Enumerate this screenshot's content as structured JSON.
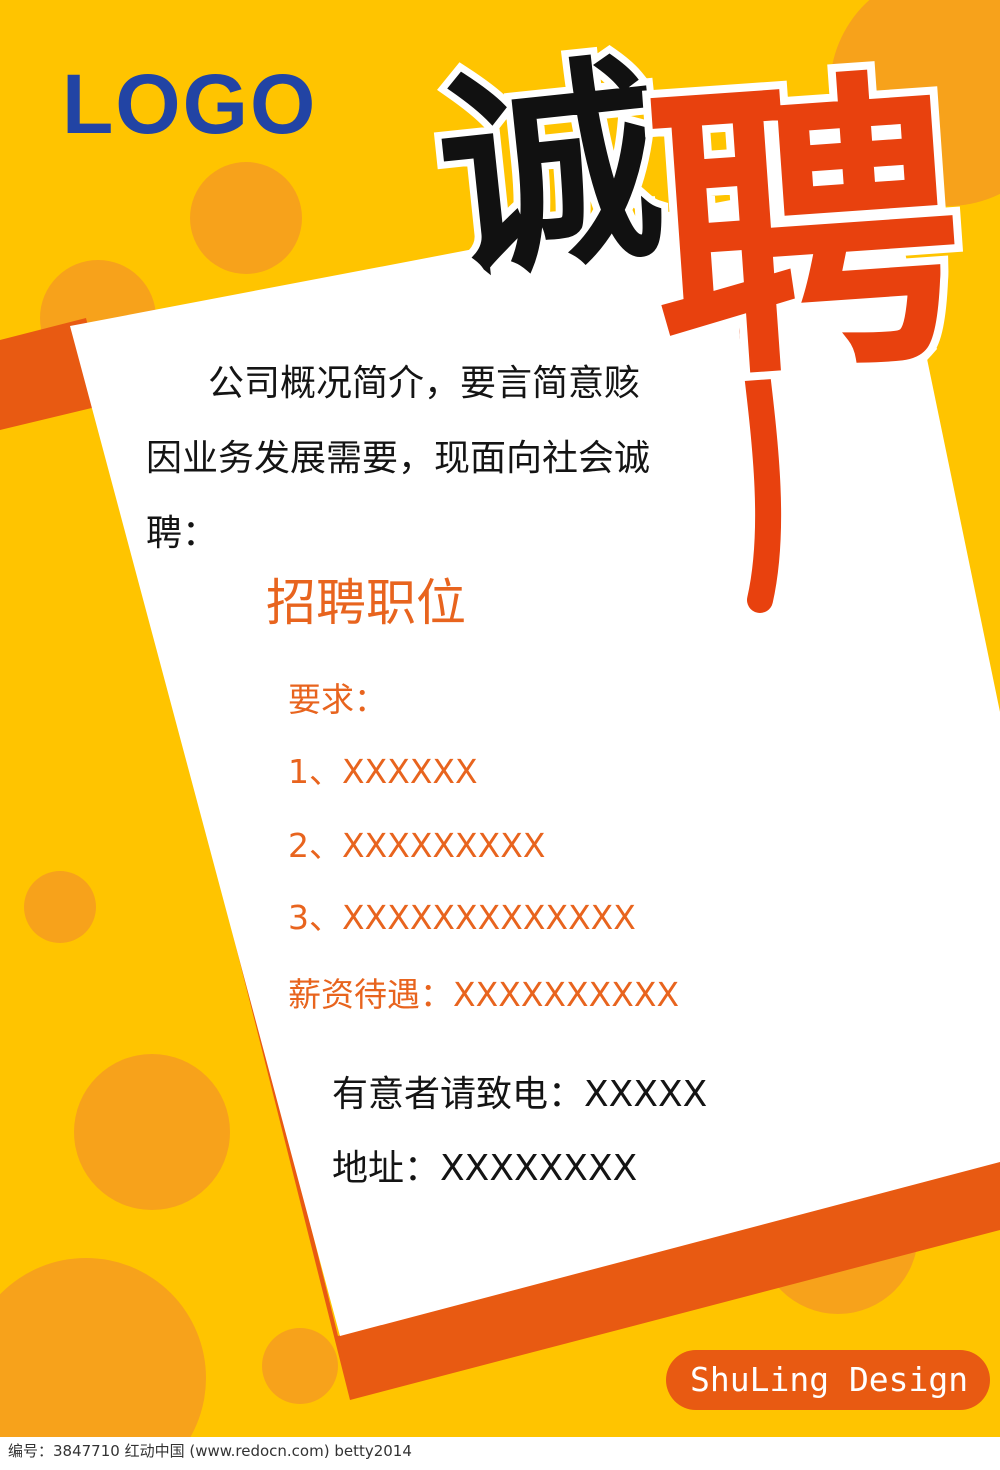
{
  "poster": {
    "logo": "LOGO",
    "headline_char_1": "诚",
    "headline_char_2": "聘",
    "intro_line_1": "公司概况简介，要言简意赅",
    "intro_line_2": "因业务发展需要，现面向社会诚",
    "intro_line_3": "聘：",
    "positions_title": "招聘职位",
    "requirements_label": "要求：",
    "requirements": [
      "1、XXXXXX",
      "2、XXXXXXXXX",
      "3、XXXXXXXXXXXXX"
    ],
    "salary": "薪资待遇：XXXXXXXXXX",
    "contact_phone": "有意者请致电：XXXXX",
    "contact_address": "地址：XXXXXXXX",
    "signature": "ShuLing Design"
  },
  "footer": {
    "watermark": "编号：3847710    红动中国 (www.redocn.com)    betty2014"
  },
  "colors": {
    "background_yellow": "#FFC400",
    "circle_orange": "#F7A21B",
    "band_orange": "#E85A12",
    "logo_blue": "#2244A4",
    "headline_red": "#E8410E",
    "headline_black": "#111111",
    "body_orange": "#E8641E"
  }
}
